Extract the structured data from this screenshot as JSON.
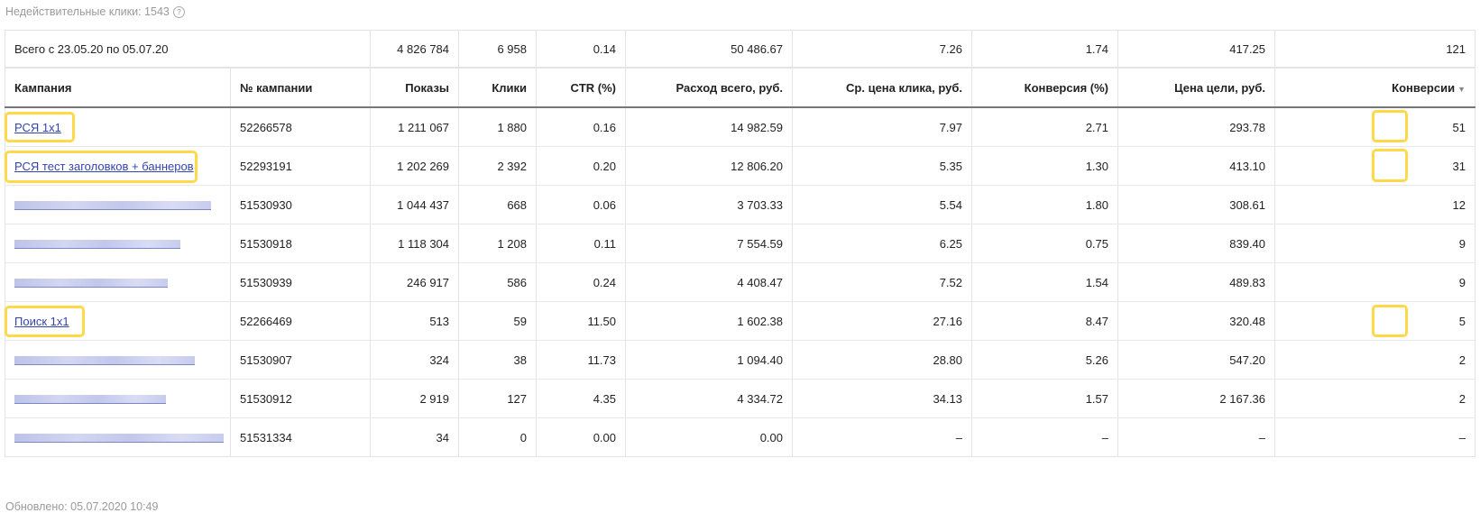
{
  "invalid_clicks": {
    "label": "Недействительные клики: 1543",
    "help": "?"
  },
  "totals": {
    "label": "Всего с 23.05.20 по 05.07.20",
    "impressions": "4 826 784",
    "clicks": "6 958",
    "ctr": "0.14",
    "spend": "50 486.67",
    "avg_cpc": "7.26",
    "conversion_rate": "1.74",
    "goal_cost": "417.25",
    "conversions": "121"
  },
  "columns": {
    "campaign": "Кампания",
    "campaign_id": "№ кампании",
    "impressions": "Показы",
    "clicks": "Клики",
    "ctr": "CTR (%)",
    "spend": "Расход всего, руб.",
    "avg_cpc": "Ср. цена клика, руб.",
    "conversion_rate": "Конверсия (%)",
    "goal_cost": "Цена цели, руб.",
    "conversions": "Конверсии",
    "sort_icon": "▼"
  },
  "rows": [
    {
      "name": "РСЯ 1x1",
      "id": "52266578",
      "impressions": "1 211 067",
      "clicks": "1 880",
      "ctr": "0.16",
      "spend": "14 982.59",
      "avg_cpc": "7.97",
      "conversion_rate": "2.71",
      "goal_cost": "293.78",
      "conversions": "51"
    },
    {
      "name": "РСЯ тест заголовков + баннеров",
      "id": "52293191",
      "impressions": "1 202 269",
      "clicks": "2 392",
      "ctr": "0.20",
      "spend": "12 806.20",
      "avg_cpc": "5.35",
      "conversion_rate": "1.30",
      "goal_cost": "413.10",
      "conversions": "31"
    },
    {
      "name": "",
      "id": "51530930",
      "impressions": "1 044 437",
      "clicks": "668",
      "ctr": "0.06",
      "spend": "3 703.33",
      "avg_cpc": "5.54",
      "conversion_rate": "1.80",
      "goal_cost": "308.61",
      "conversions": "12"
    },
    {
      "name": "",
      "id": "51530918",
      "impressions": "1 118 304",
      "clicks": "1 208",
      "ctr": "0.11",
      "spend": "7 554.59",
      "avg_cpc": "6.25",
      "conversion_rate": "0.75",
      "goal_cost": "839.40",
      "conversions": "9"
    },
    {
      "name": "",
      "id": "51530939",
      "impressions": "246 917",
      "clicks": "586",
      "ctr": "0.24",
      "spend": "4 408.47",
      "avg_cpc": "7.52",
      "conversion_rate": "1.54",
      "goal_cost": "489.83",
      "conversions": "9"
    },
    {
      "name": "Поиск 1x1",
      "id": "52266469",
      "impressions": "513",
      "clicks": "59",
      "ctr": "11.50",
      "spend": "1 602.38",
      "avg_cpc": "27.16",
      "conversion_rate": "8.47",
      "goal_cost": "320.48",
      "conversions": "5"
    },
    {
      "name": "",
      "id": "51530907",
      "impressions": "324",
      "clicks": "38",
      "ctr": "11.73",
      "spend": "1 094.40",
      "avg_cpc": "28.80",
      "conversion_rate": "5.26",
      "goal_cost": "547.20",
      "conversions": "2"
    },
    {
      "name": "",
      "id": "51530912",
      "impressions": "2 919",
      "clicks": "127",
      "ctr": "4.35",
      "spend": "4 334.72",
      "avg_cpc": "34.13",
      "conversion_rate": "1.57",
      "goal_cost": "2 167.36",
      "conversions": "2"
    },
    {
      "name": "",
      "id": "51531334",
      "impressions": "34",
      "clicks": "0",
      "ctr": "0.00",
      "spend": "0.00",
      "avg_cpc": "–",
      "conversion_rate": "–",
      "goal_cost": "–",
      "conversions": "–"
    }
  ],
  "highlight_color": "#ffd94a",
  "link_color": "#3444b0",
  "updated": "Обновлено: 05.07.2020 10:49"
}
